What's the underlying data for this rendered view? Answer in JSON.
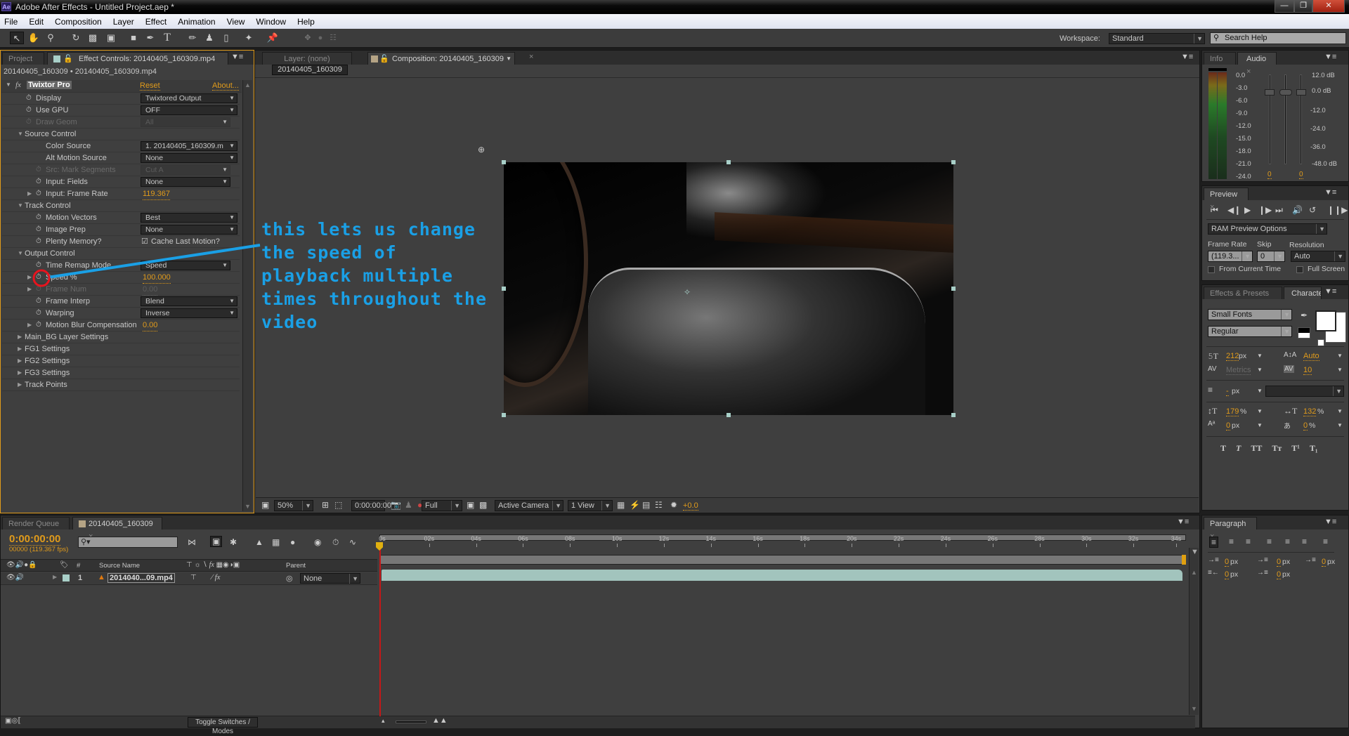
{
  "window": {
    "app_icon": "Ae",
    "title": "Adobe After Effects - Untitled Project.aep *",
    "controls": [
      "minimize",
      "restore",
      "close"
    ]
  },
  "menu": [
    "File",
    "Edit",
    "Composition",
    "Layer",
    "Effect",
    "Animation",
    "View",
    "Window",
    "Help"
  ],
  "toolbar": {
    "tools": [
      "selection-tool",
      "hand-tool",
      "zoom-tool",
      "rotate-tool",
      "camera-tool",
      "pan-behind-tool",
      "rectangle-tool",
      "pen-tool",
      "type-tool",
      "brush-tool",
      "clone-stamp-tool",
      "eraser-tool",
      "roto-brush-tool",
      "puppet-pin-tool"
    ],
    "axis_tools": [
      "local-axis",
      "world-axis",
      "view-axis"
    ],
    "workspace_label": "Workspace:",
    "workspace_value": "Standard",
    "search_placeholder": "Search Help"
  },
  "left_panel": {
    "tabs": [
      "Project",
      "Effect Controls: 20140405_160309.mp4"
    ],
    "breadcrumb": "20140405_160309 • 20140405_160309.mp4",
    "effect_name": "Twixtor Pro",
    "reset_label": "Reset",
    "about_label": "About...",
    "rows": [
      {
        "label": "Display",
        "type": "select",
        "value": "Twixtored Output"
      },
      {
        "label": "Use GPU",
        "type": "select",
        "value": "OFF"
      },
      {
        "label": "Draw Geom",
        "type": "select",
        "value": "All",
        "disabled": true
      },
      {
        "label": "Source Control",
        "type": "group"
      },
      {
        "label": "Color Source",
        "type": "select",
        "value": "1. 20140405_160309.m"
      },
      {
        "label": "Alt Motion Source",
        "type": "select",
        "value": "None"
      },
      {
        "label": "Src: Mark Segments",
        "type": "select",
        "value": "Cut A",
        "disabled": true
      },
      {
        "label": "Input: Fields",
        "type": "select",
        "value": "None"
      },
      {
        "label": "Input: Frame Rate",
        "type": "number",
        "value": "119.367"
      },
      {
        "label": "Track Control",
        "type": "group"
      },
      {
        "label": "Motion Vectors",
        "type": "select",
        "value": "Best"
      },
      {
        "label": "Image Prep",
        "type": "select",
        "value": "None"
      },
      {
        "label": "Plenty Memory?",
        "type": "checkbox",
        "value": "Cache Last Motion?",
        "checked": true
      },
      {
        "label": "Output Control",
        "type": "group"
      },
      {
        "label": "Time Remap Mode",
        "type": "select",
        "value": "Speed"
      },
      {
        "label": "Speed %",
        "type": "number",
        "value": "100.000"
      },
      {
        "label": "Frame Num",
        "type": "number",
        "value": "0.00",
        "disabled": true
      },
      {
        "label": "Frame Interp",
        "type": "select",
        "value": "Blend"
      },
      {
        "label": "Warping",
        "type": "select",
        "value": "Inverse"
      },
      {
        "label": "Motion Blur Compensation",
        "type": "number",
        "value": "0.00"
      },
      {
        "label": "Main_BG Layer Settings",
        "type": "collapsed-group"
      },
      {
        "label": "FG1 Settings",
        "type": "collapsed-group"
      },
      {
        "label": "FG2 Settings",
        "type": "collapsed-group"
      },
      {
        "label": "FG3 Settings",
        "type": "collapsed-group"
      },
      {
        "label": "Track Points",
        "type": "collapsed-group"
      }
    ]
  },
  "annotation": {
    "text_lines": [
      "this lets us change",
      "the speed of",
      "playback multiple",
      "times throughout the",
      "video"
    ],
    "color": "#1aa0e6",
    "highlight_color": "#e8141e"
  },
  "viewer": {
    "tabs": [
      "Layer: (none)",
      "Composition: 20140405_160309"
    ],
    "comp_button": "20140405_160309",
    "footer": {
      "magnification": "50%",
      "timecode": "0:00:00:00",
      "resolution": "Full",
      "camera": "Active Camera",
      "views": "1 View",
      "exposure": "+0.0"
    }
  },
  "info_audio": {
    "tabs": [
      "Info",
      "Audio"
    ],
    "meter_labels": [
      "0.0",
      "-3.0",
      "-6.0",
      "-9.0",
      "-12.0",
      "-15.0",
      "-18.0",
      "-21.0",
      "-24.0"
    ],
    "db_labels": [
      "12.0 dB",
      "0.0 dB",
      "-12.0",
      "-24.0",
      "-36.0",
      "-48.0 dB"
    ],
    "left_value": "0",
    "right_value": "0"
  },
  "preview": {
    "tab": "Preview",
    "ram_options": "RAM Preview Options",
    "frame_rate_label": "Frame Rate",
    "frame_rate_value": "(119.3...",
    "skip_label": "Skip",
    "skip_value": "0",
    "resolution_label": "Resolution",
    "resolution_value": "Auto",
    "from_current_time": "From Current Time",
    "full_screen": "Full Screen"
  },
  "character": {
    "tabs": [
      "Effects & Presets",
      "Characte"
    ],
    "font": "Small Fonts",
    "style": "Regular",
    "size": "212",
    "size_unit": "px",
    "leading": "Auto",
    "kerning": "Metrics",
    "tracking": "10",
    "stroke_width": "-",
    "stroke_unit": "px",
    "vert_scale": "179",
    "horiz_scale": "132",
    "baseline_shift": "0",
    "tsume": "0",
    "pct": "%",
    "px": "px",
    "style_buttons": [
      "T",
      "T",
      "TT",
      "Tт",
      "T¹",
      "T₁"
    ]
  },
  "paragraph": {
    "tab": "Paragraph",
    "indents": [
      "0",
      "0",
      "0",
      "0",
      "0"
    ],
    "unit": "px"
  },
  "timeline": {
    "tabs": [
      "Render Queue",
      "20140405_160309"
    ],
    "timecode": "0:00:00:00",
    "frame_info": "00000 (119.367 fps)",
    "columns": [
      "#",
      "Source Name",
      "Parent"
    ],
    "layers": [
      {
        "num": "1",
        "name": "2014040...09.mp4",
        "parent": "None"
      }
    ],
    "ruler": [
      "0s",
      "02s",
      "04s",
      "06s",
      "08s",
      "10s",
      "12s",
      "14s",
      "16s",
      "18s",
      "20s",
      "22s",
      "24s",
      "26s",
      "28s",
      "30s",
      "32s",
      "34s"
    ],
    "toggle_label": "Toggle Switches / Modes"
  }
}
